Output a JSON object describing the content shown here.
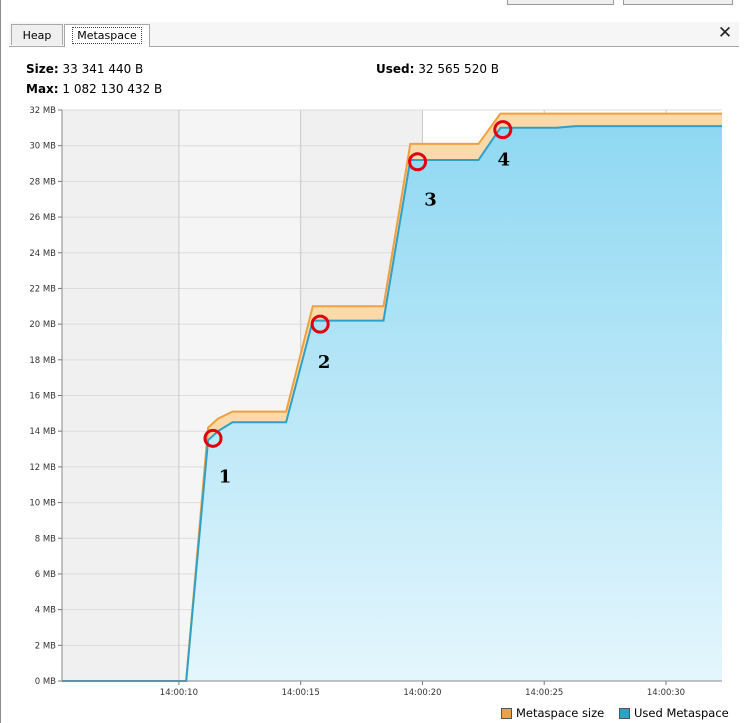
{
  "tabs": [
    {
      "label": "Heap",
      "active": false
    },
    {
      "label": "Metaspace",
      "active": true
    }
  ],
  "close_icon": "close-icon",
  "stats": {
    "size_label": "Size:",
    "size_value": "33 341 440 B",
    "used_label": "Used:",
    "used_value": "32 565 520 B",
    "max_label": "Max:",
    "max_value": "1 082 130 432 B"
  },
  "colors": {
    "metaspace_size": "#f0a040",
    "metaspace_size_fill": "#fbd9a8",
    "used_metaspace": "#2fa1c6",
    "used_fill_top": "#8fd8f2",
    "used_fill_bottom": "#e4f6fd",
    "annotation": "#e00010"
  },
  "chart_data": {
    "type": "area",
    "x_unit": "time",
    "xlim": [
      "14:00:05.2",
      "14:00:32.3"
    ],
    "ylim": [
      0,
      32
    ],
    "y_ticks": [
      "0 MB",
      "2 MB",
      "4 MB",
      "6 MB",
      "8 MB",
      "10 MB",
      "12 MB",
      "14 MB",
      "16 MB",
      "18 MB",
      "20 MB",
      "22 MB",
      "24 MB",
      "26 MB",
      "28 MB",
      "30 MB",
      "32 MB"
    ],
    "x_ticks": [
      "14:00:10",
      "14:00:15",
      "14:00:20",
      "14:00:25",
      "14:00:30"
    ],
    "grid": true,
    "legend_position": "bottom-right",
    "series": [
      {
        "name": "Metaspace size",
        "points": [
          [
            "14:00:05.2",
            0
          ],
          [
            "14:00:10.3",
            0
          ],
          [
            "14:00:11.2",
            14.2
          ],
          [
            "14:00:11.6",
            14.7
          ],
          [
            "14:00:12.2",
            15.1
          ],
          [
            "14:00:14.4",
            15.1
          ],
          [
            "14:00:15.5",
            21.0
          ],
          [
            "14:00:18.4",
            21.0
          ],
          [
            "14:00:19.5",
            30.1
          ],
          [
            "14:00:22.3",
            30.1
          ],
          [
            "14:00:23.2",
            31.8
          ],
          [
            "14:00:32.3",
            31.8
          ]
        ]
      },
      {
        "name": "Used Metaspace",
        "points": [
          [
            "14:00:05.2",
            0
          ],
          [
            "14:00:10.3",
            0
          ],
          [
            "14:00:11.2",
            13.5
          ],
          [
            "14:00:11.6",
            14.0
          ],
          [
            "14:00:12.2",
            14.5
          ],
          [
            "14:00:14.4",
            14.5
          ],
          [
            "14:00:15.5",
            20.2
          ],
          [
            "14:00:18.4",
            20.2
          ],
          [
            "14:00:19.5",
            29.2
          ],
          [
            "14:00:22.3",
            29.2
          ],
          [
            "14:00:23.2",
            31.0
          ],
          [
            "14:00:25.5",
            31.0
          ],
          [
            "14:00:26.3",
            31.1
          ],
          [
            "14:00:32.3",
            31.1
          ]
        ]
      }
    ],
    "annotations": [
      {
        "label": "1",
        "x": "14:00:11.4",
        "y": 13.6
      },
      {
        "label": "2",
        "x": "14:00:15.8",
        "y": 20.0
      },
      {
        "label": "3",
        "x": "14:00:19.8",
        "y": 29.1
      },
      {
        "label": "4",
        "x": "14:00:23.3",
        "y": 30.9
      }
    ]
  }
}
